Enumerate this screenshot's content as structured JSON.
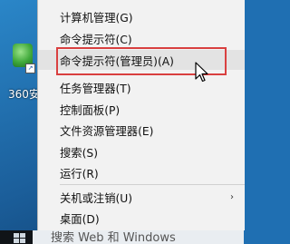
{
  "desktop": {
    "icon_label": "360安"
  },
  "menu": {
    "items": [
      {
        "label": "计算机管理(G)"
      },
      {
        "label": "命令提示符(C)"
      },
      {
        "label": "命令提示符(管理员)(A)"
      },
      {
        "label": "任务管理器(T)"
      },
      {
        "label": "控制面板(P)"
      },
      {
        "label": "文件资源管理器(E)"
      },
      {
        "label": "搜索(S)"
      },
      {
        "label": "运行(R)"
      },
      {
        "label": "关机或注销(U)"
      },
      {
        "label": "桌面(D)"
      }
    ],
    "submenu_glyph": "›",
    "highlight_color": "#d94040"
  },
  "taskbar": {
    "search_text": "搜索 Web 和 Windows"
  },
  "icons": {
    "desktop_app": "360-security-icon",
    "shortcut": "shortcut-arrow-icon",
    "start": "windows-start-icon",
    "cursor": "mouse-pointer-icon",
    "chevron": "chevron-right-icon"
  }
}
